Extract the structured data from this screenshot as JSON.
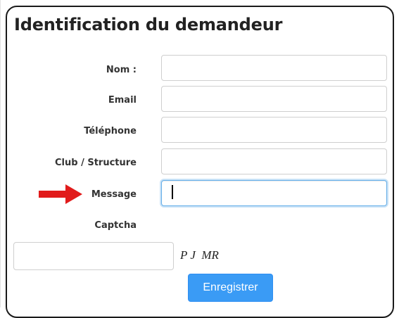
{
  "form": {
    "title": "Identification du demandeur",
    "fields": [
      {
        "label": "Nom :",
        "value": "",
        "focused": false
      },
      {
        "label": "Email",
        "value": "",
        "focused": false
      },
      {
        "label": "Téléphone",
        "value": "",
        "focused": false
      },
      {
        "label": "Club / Structure",
        "value": "",
        "focused": false
      },
      {
        "label": "Message",
        "value": "",
        "focused": true
      }
    ],
    "captcha": {
      "label": "Captcha",
      "value": "",
      "code": "P J  MR"
    },
    "submit_label": "Enregistrer"
  },
  "annotation": {
    "arrow_color": "#e11b1b",
    "points_to": "Message"
  },
  "colors": {
    "button_bg": "#3a9bf5",
    "focus_border": "#66afe9",
    "title_text": "#222222"
  }
}
